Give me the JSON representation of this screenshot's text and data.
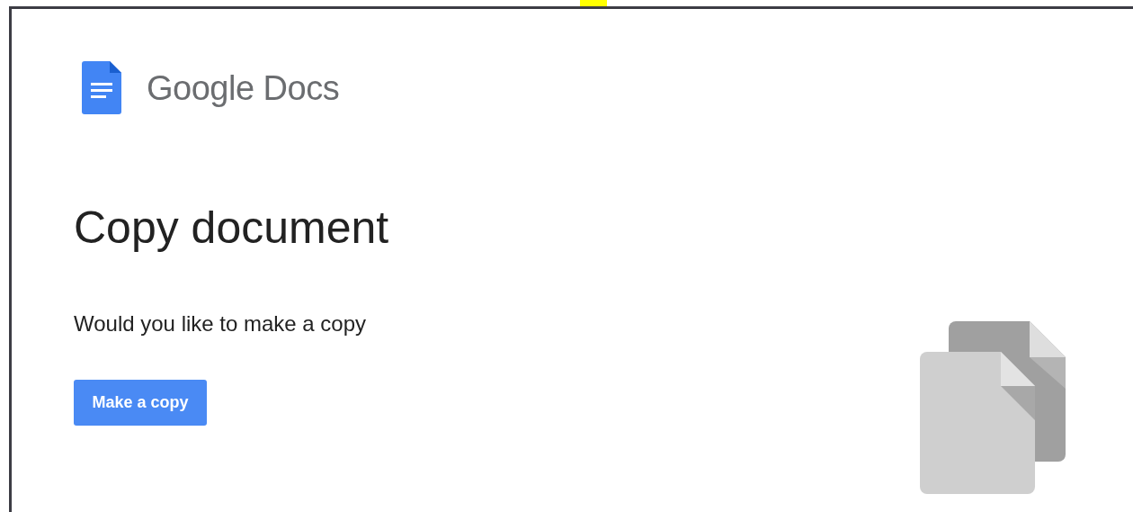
{
  "brand": {
    "name": "Google Docs"
  },
  "page": {
    "title": "Copy document",
    "message": "Would you like to make a copy",
    "button": "Make a copy"
  }
}
